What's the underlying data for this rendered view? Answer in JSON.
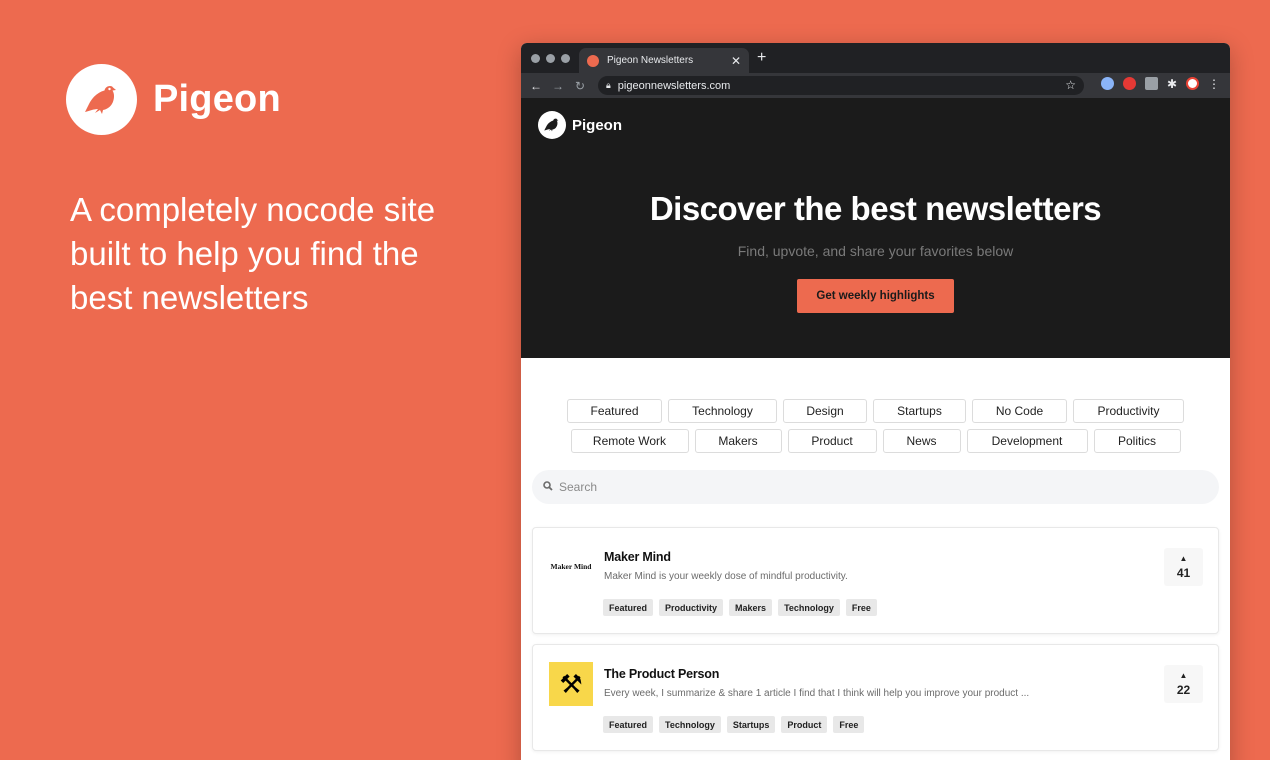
{
  "promo": {
    "brand": "Pigeon",
    "tagline": "A completely nocode site built to help you find the best newsletters"
  },
  "browser": {
    "tab_title": "Pigeon Newsletters",
    "url": "pigeonnewsletters.com"
  },
  "site": {
    "brand": "Pigeon",
    "headline": "Discover the best newsletters",
    "subheadline": "Find, upvote, and share your favorites below",
    "cta": "Get weekly highlights"
  },
  "categories": {
    "row1": [
      "Featured",
      "Technology",
      "Design",
      "Startups",
      "No Code",
      "Productivity"
    ],
    "row2": [
      "Remote Work",
      "Makers",
      "Product",
      "News",
      "Development",
      "Politics"
    ]
  },
  "search": {
    "placeholder": "Search"
  },
  "newsletters": [
    {
      "thumb_text": "Maker Mind",
      "title": "Maker Mind",
      "description": "Maker Mind is your weekly dose of mindful productivity.",
      "tags": [
        "Featured",
        "Productivity",
        "Makers",
        "Technology",
        "Free"
      ],
      "votes": "41"
    },
    {
      "thumb_icon": "hammer-and-wrench-icon",
      "title": "The Product Person",
      "description": "Every week, I summarize & share 1 article I find that I think will help you improve your product ...",
      "tags": [
        "Featured",
        "Technology",
        "Startups",
        "Product",
        "Free"
      ],
      "votes": "22"
    }
  ],
  "colors": {
    "accent": "#ed6a4f",
    "hero_bg": "#1b1b1b"
  }
}
